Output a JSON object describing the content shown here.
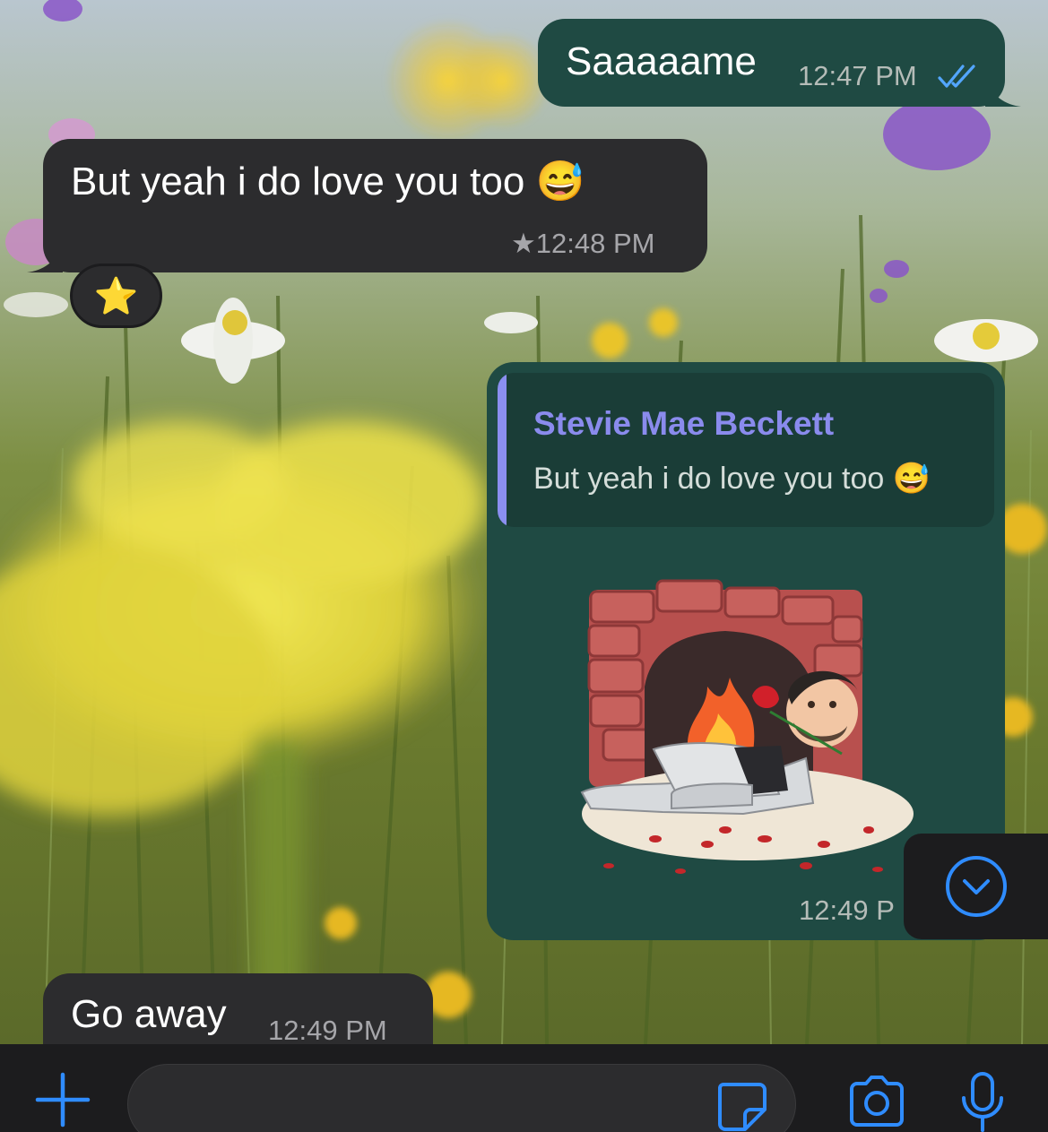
{
  "messages": [
    {
      "id": "m1",
      "direction": "outgoing",
      "text": "Saaaaame",
      "time": "12:47 PM",
      "status": "read"
    },
    {
      "id": "m2",
      "direction": "incoming",
      "text": "But yeah i do love you too 😅",
      "time": "12:48 PM",
      "starred": true,
      "reaction": "⭐"
    },
    {
      "id": "m3",
      "direction": "outgoing",
      "quote": {
        "author": "Stevie Mae Beckett",
        "text": "But yeah i do love you too 😅"
      },
      "sticker": "avatar-fireplace-rose-sticker",
      "time": "12:49 P"
    },
    {
      "id": "m4",
      "direction": "incoming",
      "text": "Go away",
      "time": "12:49 PM"
    }
  ],
  "star_glyph": "★",
  "input_bar": {
    "icons": [
      "plus-icon",
      "sticker-icon",
      "camera-icon",
      "microphone-icon"
    ]
  },
  "colors": {
    "accent": "#2f8cff",
    "outgoing_bubble": "#1f4a43",
    "incoming_bubble": "#2c2c2e",
    "read_ticks": "#53a6ff",
    "quote_author": "#8a8bed"
  }
}
